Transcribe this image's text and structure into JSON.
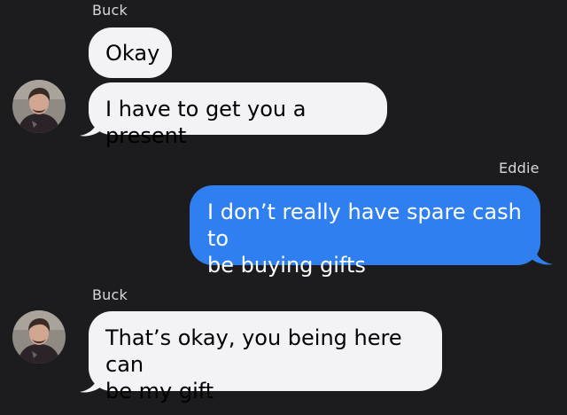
{
  "thread": {
    "messages": [
      {
        "sender": "Buck",
        "direction": "incoming",
        "text": "Okay"
      },
      {
        "sender": "Buck",
        "direction": "incoming",
        "text": "I have to get you a present"
      },
      {
        "sender": "Eddie",
        "direction": "outgoing",
        "lines": [
          "I don’t really have spare cash to",
          "be buying gifts"
        ]
      },
      {
        "sender": "Buck",
        "direction": "incoming",
        "lines": [
          "That’s okay, you being here can",
          "be my gift"
        ]
      }
    ],
    "senders": {
      "buck_label_1": "Buck",
      "eddie_label": "Eddie",
      "buck_label_2": "Buck"
    }
  },
  "icons": {
    "avatar": "contact-avatar-icon"
  },
  "colors": {
    "background": "#1c1c1e",
    "incoming_bubble": "#f2f2f7",
    "outgoing_bubble": "#2f7ff0"
  }
}
